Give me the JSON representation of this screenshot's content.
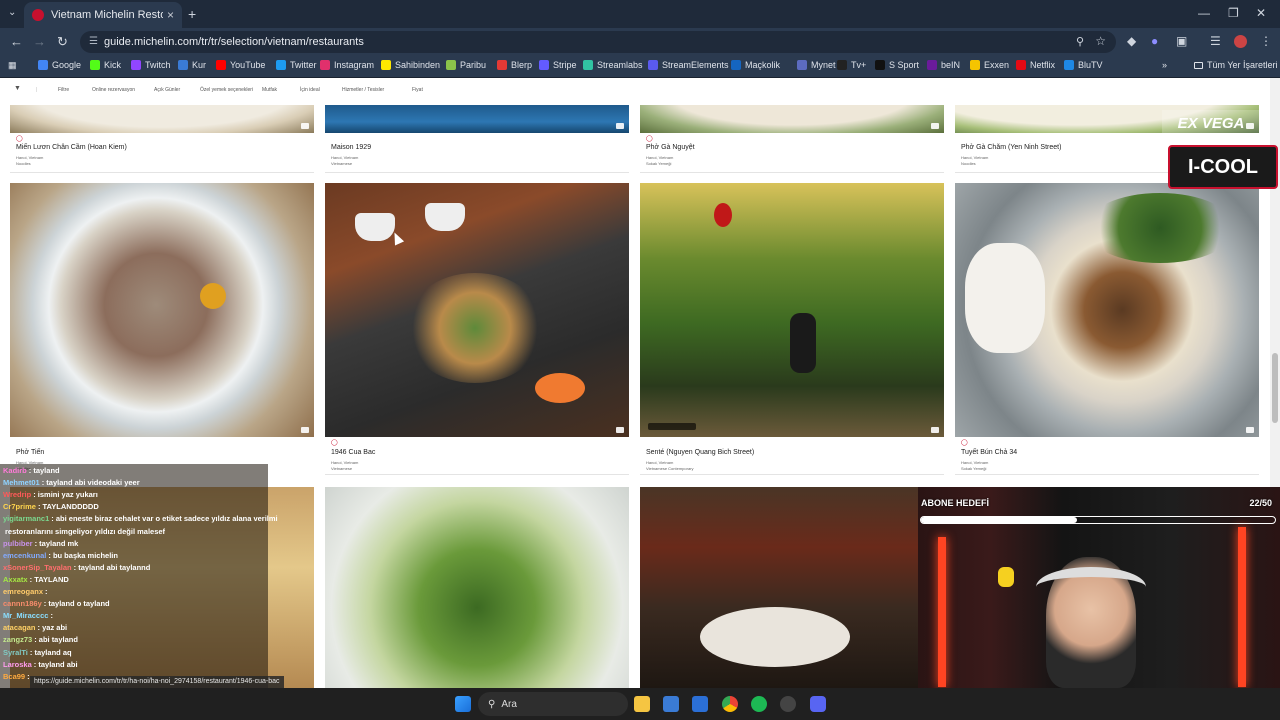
{
  "browser": {
    "tab_title": "Vietnam Michelin Restoranları",
    "tab_close": "×",
    "new_tab": "+",
    "url": "guide.michelin.com/tr/tr/selection/vietnam/restaurants",
    "all_bookmarks": "Tüm Yer İşaretleri",
    "bookmarks": [
      {
        "label": "Google",
        "color": "#4285f4"
      },
      {
        "label": "Kick",
        "color": "#53fc18"
      },
      {
        "label": "Twitch",
        "color": "#9146ff"
      },
      {
        "label": "Kur",
        "color": "#3a7bd5"
      },
      {
        "label": "YouTube",
        "color": "#ff0000"
      },
      {
        "label": "Twitter",
        "color": "#1d9bf0"
      },
      {
        "label": "Instagram",
        "color": "#e1306c"
      },
      {
        "label": "Sahibinden",
        "color": "#ffe800"
      },
      {
        "label": "Paribu",
        "color": "#8bc34a"
      },
      {
        "label": "Blerp",
        "color": "#e53935"
      },
      {
        "label": "Stripe",
        "color": "#635bff"
      },
      {
        "label": "Streamlabs",
        "color": "#31c3a2"
      },
      {
        "label": "StreamElements",
        "color": "#5a5af0"
      },
      {
        "label": "Maçkolik",
        "color": "#1565c0"
      },
      {
        "label": "Mynet",
        "color": "#5c6bc0"
      },
      {
        "label": "Tv+",
        "color": "#222222"
      },
      {
        "label": "S Sport",
        "color": "#111111"
      },
      {
        "label": "beIN",
        "color": "#6a1b9a"
      },
      {
        "label": "Exxen",
        "color": "#f5c400"
      },
      {
        "label": "Netflix",
        "color": "#e50914"
      },
      {
        "label": "BluTV",
        "color": "#1e88e5"
      }
    ]
  },
  "filters": [
    "Filtre",
    "Online rezervasyon",
    "Açık Günler",
    "Özel yemek seçenekleri",
    "Mutfak",
    "İçin ideal",
    "Hizmetler / Tesisler",
    "Fiyat"
  ],
  "cards_top": [
    {
      "name": "Miến Lươn Chân Cầm (Hoan Kiem)",
      "loc": "Hanoi, Vietnam",
      "cuisine": "Noodles"
    },
    {
      "name": "Maison 1929",
      "loc": "Hanoi, Vietnam",
      "cuisine": "Vietnamese"
    },
    {
      "name": "Phở Gà Nguyệt",
      "loc": "Hanoi, Vietnam",
      "cuisine": "Sokak Yemeği"
    },
    {
      "name": "Phở Gà Chăm (Yen Ninh Street)",
      "loc": "Hanoi, Vietnam",
      "cuisine": "Noodles"
    }
  ],
  "cards_mid": [
    {
      "name": "Phở Tiến",
      "loc": "Hanoi, Vietnam",
      "cuisine": "Noodles"
    },
    {
      "name": "1946 Cua Bac",
      "loc": "Hanoi, Vietnam",
      "cuisine": "Vietnamese"
    },
    {
      "name": "Senté (Nguyen Quang Bich Street)",
      "loc": "Hanoi, Vietnam",
      "cuisine": "Vietnamese Contemporary"
    },
    {
      "name": "Tuyết Bún Chả 34",
      "loc": "Hanoi, Vietnam",
      "cuisine": "Sokak Yemeği"
    }
  ],
  "chat": [
    {
      "user": "Kadirb",
      "msg": ": tayland",
      "color": "#ff7ad9"
    },
    {
      "user": "Mehmet01",
      "msg": ": tayland abi videodaki yeer",
      "color": "#8fd3ff"
    },
    {
      "user": "Wredrip",
      "msg": ": ismini yaz yukarı",
      "color": "#ff5959"
    },
    {
      "user": "Cr7prime",
      "msg": ": TAYLANDDDDD",
      "color": "#ffd54f"
    },
    {
      "user": "yigitarmanc1",
      "msg": ": abi eneste biraz cehalet var o etiket sadece yıldız alana verilmi",
      "color": "#7bd88f"
    },
    {
      "user": "",
      "msg": "restoranlarını simgeliyor yıldızı değil malesef",
      "color": "#ffffff"
    },
    {
      "user": "pulbiber",
      "msg": ": tayland mk",
      "color": "#c792ea"
    },
    {
      "user": "emcenkunal",
      "msg": ": bu başka michelin",
      "color": "#82aaff"
    },
    {
      "user": "xSonerSip_Tayalan",
      "msg": ": tayland abi taylannd",
      "color": "#ff6e6e"
    },
    {
      "user": "Axxatx",
      "msg": ": TAYLAND",
      "color": "#a5e844"
    },
    {
      "user": "emreoganx",
      "msg": ":",
      "color": "#ffcb6b"
    },
    {
      "user": "cannn186y",
      "msg": ": tayland o tayland",
      "color": "#f78c6c"
    },
    {
      "user": "Mr_Miracccc",
      "msg": ":",
      "color": "#89ddff"
    },
    {
      "user": "atacagan",
      "msg": ": yaz abi",
      "color": "#ffd166"
    },
    {
      "user": "zangz73",
      "msg": ": abi tayland",
      "color": "#c3e88d"
    },
    {
      "user": "SyralTi",
      "msg": ": tayland aq",
      "color": "#80cbc4"
    },
    {
      "user": "Laroska",
      "msg": ": tayland abi",
      "color": "#ff9cee"
    },
    {
      "user": "Bca99",
      "msg": ":",
      "color": "#ffab40"
    }
  ],
  "status_url": "https://guide.michelin.com/tr/tr/ha-noi/ha-noi_2974158/restaurant/1946-cua-bac",
  "stream": {
    "goal_title": "ABONE HEDEFİ",
    "goal_value": "22/50",
    "goal_progress": 0.44
  },
  "taskbar": {
    "search_label": "Ara"
  },
  "colors": {
    "michelin_red": "#c8102e",
    "browser_dark": "#1f2a3a"
  }
}
